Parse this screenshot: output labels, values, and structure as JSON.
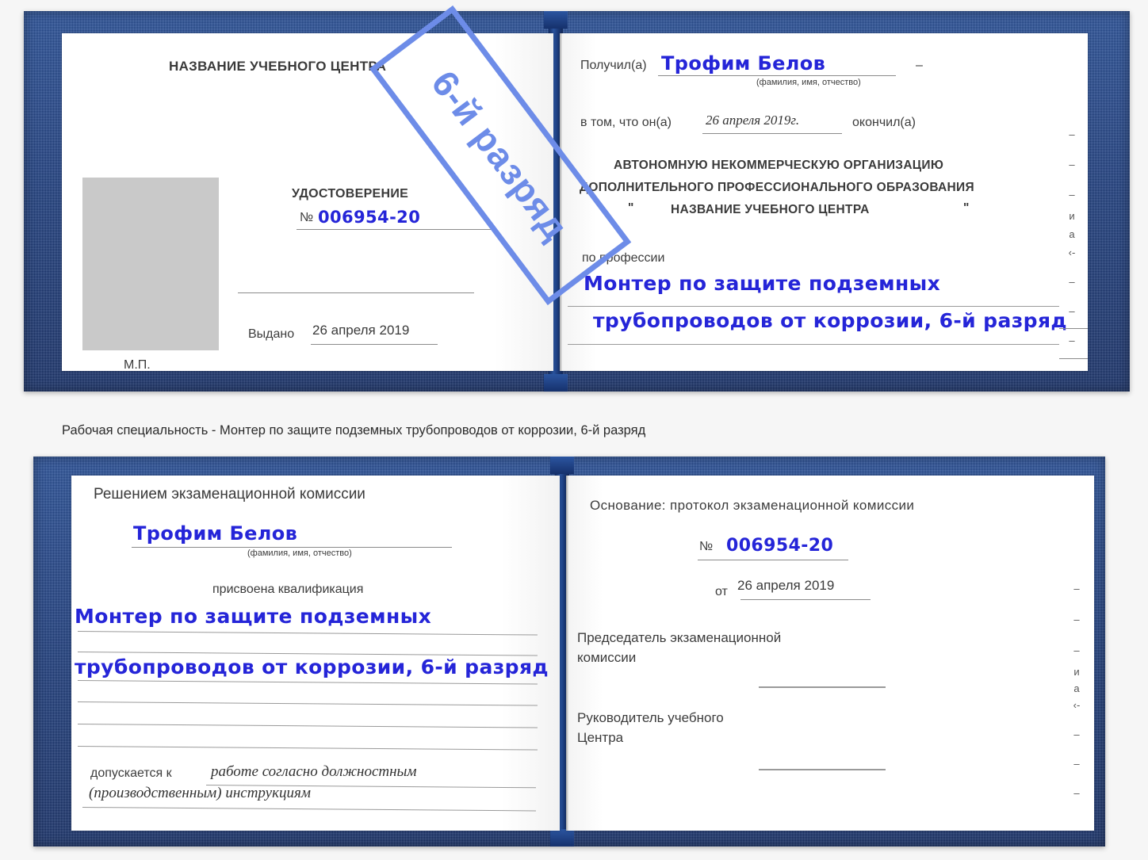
{
  "caption": "Рабочая специальность - Монтер по защите подземных трубопроводов от коррозии, 6-й разряд",
  "watermark": {
    "text": "6-й разряд",
    "color": "#6d8ce8"
  },
  "colors": {
    "binding": "#1e3f82",
    "handwriting": "#2525d8",
    "photo_placeholder": "#c9c9c9",
    "rule": "#8b8b8b"
  },
  "cert_top": {
    "left_page": {
      "header": "НАЗВАНИЕ УЧЕБНОГО ЦЕНТРА",
      "doc_title": "УДОСТОВЕРЕНИЕ",
      "number_label": "№",
      "number_value": "006954-20",
      "issued_label": "Выдано",
      "issued_value": "26 апреля 2019",
      "seal_mark": "М.П."
    },
    "right_page": {
      "received_label": "Получил(а)",
      "received_value": "Трофим Белов",
      "fio_hint": "(фамилия, имя, отчество)",
      "that_he_label": "в том, что он(а)",
      "that_he_value": "26 апреля 2019г.",
      "finished_label": "окончил(а)",
      "org_line1": "АВТОНОМНУЮ НЕКОММЕРЧЕСКУЮ ОРГАНИЗАЦИЮ",
      "org_line2": "ДОПОЛНИТЕЛЬНОГО ПРОФЕССИОНАЛЬНОГО ОБРАЗОВАНИЯ",
      "org_quote_open": "\"",
      "org_line3": "НАЗВАНИЕ УЧЕБНОГО ЦЕНТРА",
      "org_quote_close": "\"",
      "profession_label": "по профессии",
      "profession_line1": "Монтер по защите подземных",
      "profession_line2": "трубопроводов от коррозии, 6-й разряд",
      "edge_fragments": [
        "–",
        "–",
        "–",
        "и",
        "а",
        "‹-",
        "–",
        "–",
        "–"
      ]
    }
  },
  "cert_bottom": {
    "left_page": {
      "header": "Решением экзаменационной комиссии",
      "name_value": "Трофим Белов",
      "fio_hint": "(фамилия, имя, отчество)",
      "qualification_label": "присвоена квалификация",
      "qualification_line1": "Монтер по защите подземных",
      "qualification_line2": "трубопроводов от коррозии, 6-й разряд",
      "allowed_label": "допускается к",
      "allowed_value1": "работе согласно должностным",
      "allowed_value2": "(производственным) инструкциям"
    },
    "right_page": {
      "basis_label": "Основание: протокол экзаменационной комиссии",
      "number_label": "№",
      "number_value": "006954-20",
      "date_label": "от",
      "date_value": "26 апреля 2019",
      "chairman_line1": "Председатель экзаменационной",
      "chairman_line2": "комиссии",
      "head_line1": "Руководитель учебного",
      "head_line2": "Центра",
      "edge_fragments": [
        "–",
        "–",
        "–",
        "и",
        "а",
        "‹-",
        "–",
        "–",
        "–"
      ]
    }
  }
}
